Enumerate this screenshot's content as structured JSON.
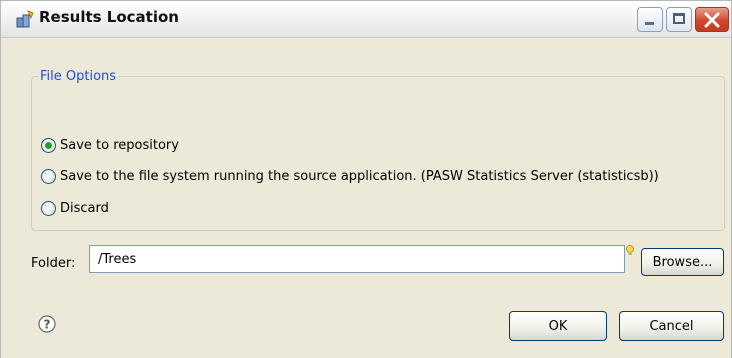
{
  "window": {
    "title": "Results Location"
  },
  "file_options": {
    "legend": "File Options",
    "options": [
      {
        "label": "Save to repository",
        "selected": true
      },
      {
        "label": "Save to the file system running the source application. (PASW Statistics Server (statisticsb))",
        "selected": false
      },
      {
        "label": "Discard",
        "selected": false
      }
    ]
  },
  "folder": {
    "label": "Folder:",
    "value": "/Trees",
    "browse_label": "Browse..."
  },
  "buttons": {
    "ok_label": "OK",
    "cancel_label": "Cancel"
  },
  "icons": {
    "app": "results-location-icon",
    "help": "help-icon",
    "hint": "lightbulb-icon"
  },
  "colors": {
    "legend": "#1f4fd0",
    "radio_selected": "#21a121",
    "dialog_bg": "#ece9d8"
  }
}
